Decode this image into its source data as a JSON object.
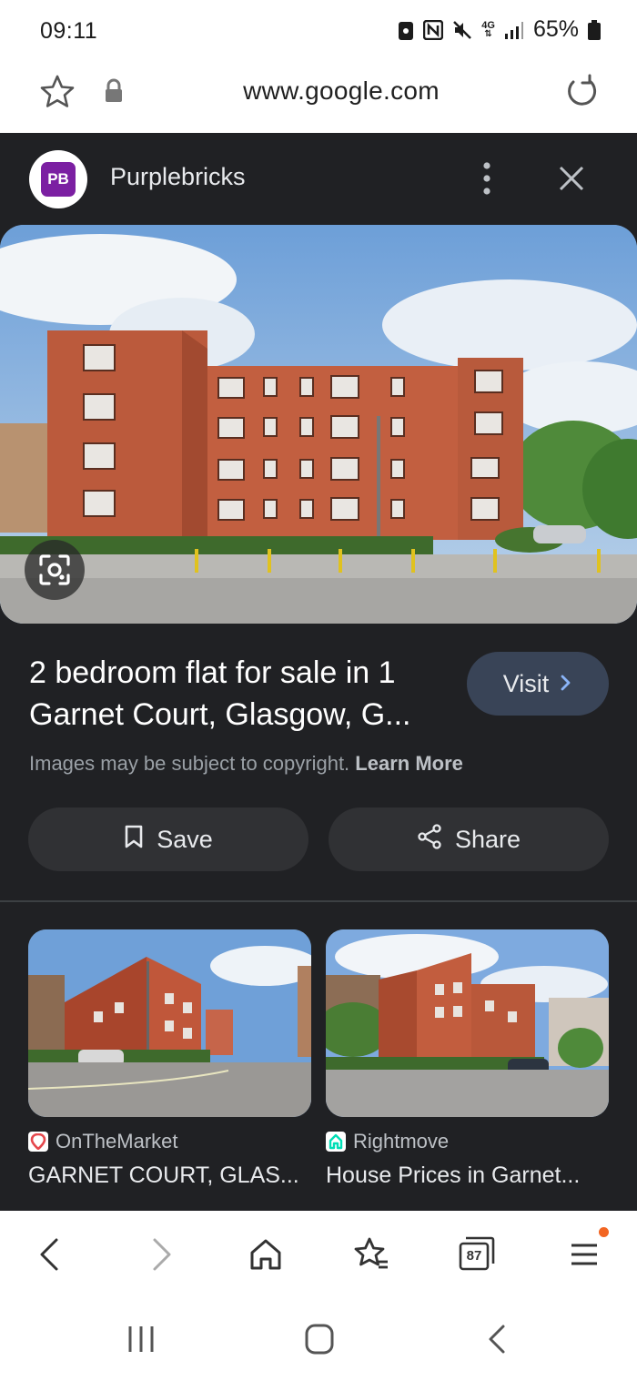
{
  "status_bar": {
    "time": "09:11",
    "battery": "65%",
    "network": "4G"
  },
  "browser": {
    "url": "www.google.com"
  },
  "source": {
    "logo_text": "PB",
    "name": "Purplebricks",
    "logo_color": "#7b1fa2"
  },
  "result": {
    "title": "2 bedroom flat for sale in 1 Garnet Court, Glasgow, G...",
    "visit_label": "Visit",
    "copyright_text": "Images may be subject to copyright.",
    "learn_more": "Learn More",
    "save_label": "Save",
    "share_label": "Share"
  },
  "related": [
    {
      "source": "OnTheMarket",
      "title": "GARNET COURT, GLAS...",
      "icon_color": "#e5484d"
    },
    {
      "source": "Rightmove",
      "title": "House Prices in Garnet...",
      "icon_color": "#00deb6"
    }
  ],
  "toolbar": {
    "tabs_count": "87",
    "accent": "#f26522"
  },
  "icons": [
    "star-icon",
    "lock-icon",
    "reload-icon",
    "more-vert-icon",
    "close-icon",
    "lens-icon",
    "chevron-right-icon",
    "bookmark-icon",
    "share-icon",
    "back-icon",
    "forward-icon",
    "home-icon",
    "bookmarks-icon",
    "tabs-icon",
    "menu-icon",
    "recents-icon",
    "home-nav-icon",
    "back-nav-icon"
  ]
}
